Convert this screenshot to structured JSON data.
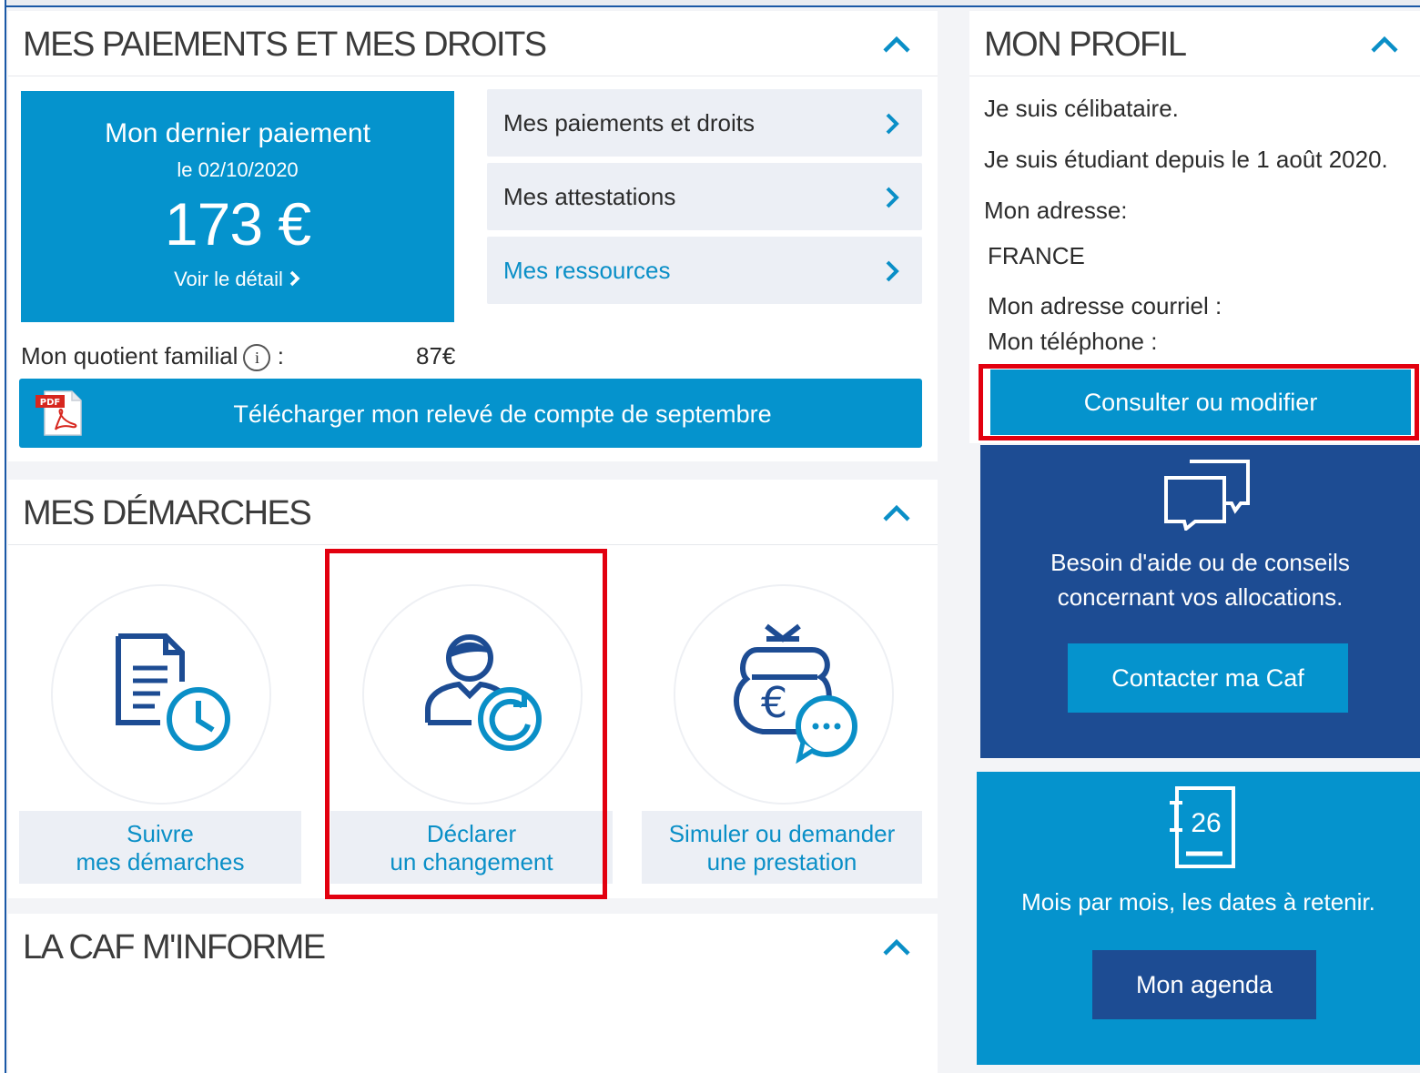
{
  "paiements": {
    "title": "MES PAIEMENTS ET MES DROITS",
    "last_payment": {
      "title": "Mon dernier paiement",
      "date": "le 02/10/2020",
      "amount": "173 €",
      "detail_link": "Voir le détail"
    },
    "links": [
      {
        "label": "Mes paiements et droits"
      },
      {
        "label": "Mes attestations"
      },
      {
        "label": "Mes ressources"
      }
    ],
    "quotient_label": "Mon quotient familial",
    "quotient_info": "i",
    "quotient_colon": ":",
    "quotient_value": "87€",
    "download_label": "Télécharger mon relevé de compte de septembre",
    "pdf_badge": "PDF"
  },
  "demarches": {
    "title": "MES DÉMARCHES",
    "tiles": [
      {
        "line1": "Suivre",
        "line2": "mes démarches"
      },
      {
        "line1": "Déclarer",
        "line2": "un changement"
      },
      {
        "line1": "Simuler ou demander",
        "line2": "une prestation"
      }
    ]
  },
  "caf": {
    "title": "LA CAF M'INFORME"
  },
  "profil": {
    "title": "MON PROFIL",
    "status": "Je suis célibataire.",
    "student": "Je suis étudiant depuis le 1 août 2020.",
    "address_label": "Mon adresse:",
    "address_value": "FRANCE",
    "email_label": "Mon adresse courriel :",
    "phone_label": "Mon téléphone :",
    "edit_button": "Consulter ou modifier"
  },
  "aide": {
    "line1": "Besoin d'aide ou de conseils",
    "line2": "concernant vos allocations.",
    "button": "Contacter ma Caf"
  },
  "agenda": {
    "day": "26",
    "text": "Mois par mois, les dates à retenir.",
    "button": "Mon agenda"
  },
  "colors": {
    "primary_blue": "#0593cd",
    "dark_blue": "#1d4c93",
    "icon_blue": "#1d4c93",
    "highlight_red": "#e2000f",
    "link_bg": "#eceff5"
  }
}
